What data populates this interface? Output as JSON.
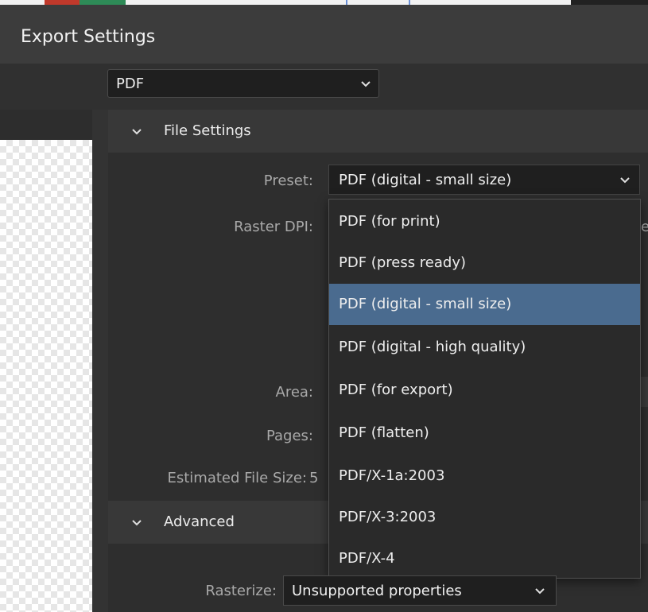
{
  "window": {
    "title": "Export Settings"
  },
  "format": {
    "selected": "PDF"
  },
  "file_settings": {
    "header": "File Settings",
    "preset_label": "Preset:",
    "preset_value": "PDF (digital - small size)",
    "raster_dpi_label": "Raster DPI:",
    "area_label": "Area:",
    "pages_label": "Pages:",
    "estimated_size_label": "Estimated File Size:",
    "estimated_size_value_fragment": "5",
    "clipped_right_fragment": "e"
  },
  "preset_dropdown": {
    "items": [
      "PDF (for print)",
      "PDF (press ready)",
      "PDF (digital - small size)",
      "PDF (digital - high quality)",
      "PDF (for export)",
      "PDF (flatten)",
      "PDF/X-1a:2003",
      "PDF/X-3:2003",
      "PDF/X-4"
    ],
    "selected_index": 2
  },
  "advanced": {
    "header": "Advanced",
    "rasterize_label": "Rasterize:",
    "rasterize_value": "Unsupported properties"
  },
  "colors": {
    "selection": "#4a6b8f",
    "panel": "#2b2b2b",
    "title_bar": "#3c3c3c"
  }
}
